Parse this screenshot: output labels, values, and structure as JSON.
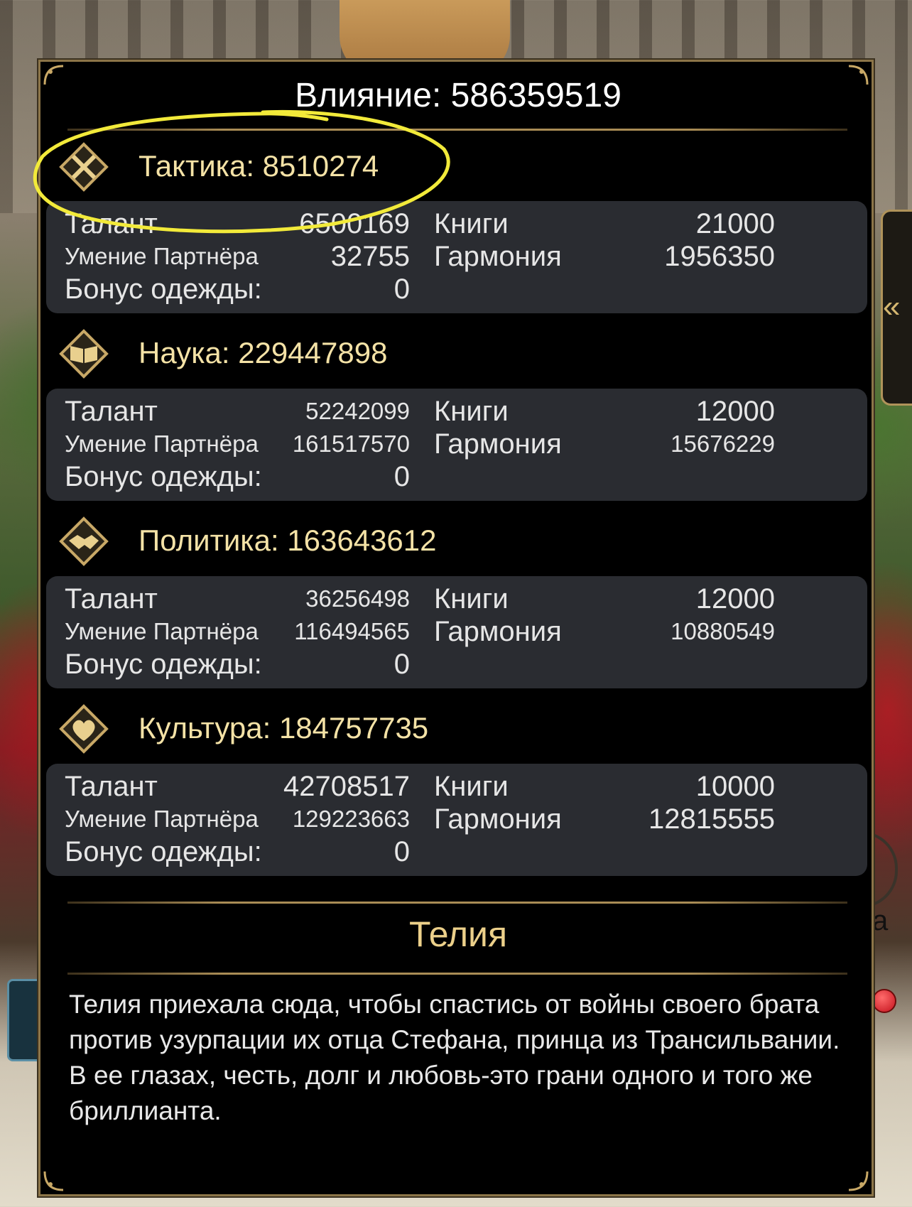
{
  "influence": {
    "label": "Влияние:",
    "value": "586359519"
  },
  "categories": [
    {
      "icon": "crossed-swords-icon",
      "title": "Тактика: 8510274",
      "talent_label": "Талант",
      "talent_value": "6500169",
      "skill_label": "Умение Партнёра",
      "skill_value": "32755",
      "dress_label": "Бонус одежды:",
      "dress_value": "0",
      "books_label": "Книги",
      "books_value": "21000",
      "harmony_label": "Гармония",
      "harmony_value": "1956350"
    },
    {
      "icon": "open-book-icon",
      "title": "Наука: 229447898",
      "talent_label": "Талант",
      "talent_value": "52242099",
      "skill_label": "Умение Партнёра",
      "skill_value": "161517570",
      "dress_label": "Бонус одежды:",
      "dress_value": "0",
      "books_label": "Книги",
      "books_value": "12000",
      "harmony_label": "Гармония",
      "harmony_value": "15676229"
    },
    {
      "icon": "handshake-icon",
      "title": "Политика: 163643612",
      "talent_label": "Талант",
      "talent_value": "36256498",
      "skill_label": "Умение Партнёра",
      "skill_value": "116494565",
      "dress_label": "Бонус одежды:",
      "dress_value": "0",
      "books_label": "Книги",
      "books_value": "12000",
      "harmony_label": "Гармония",
      "harmony_value": "10880549"
    },
    {
      "icon": "hearts-icon",
      "title": "Культура: 184757735",
      "talent_label": "Талант",
      "talent_value": "42708517",
      "skill_label": "Умение Партнёра",
      "skill_value": "129223663",
      "dress_label": "Бонус одежды:",
      "dress_value": "0",
      "books_label": "Книги",
      "books_value": "10000",
      "harmony_label": "Гармония",
      "harmony_value": "12815555"
    }
  ],
  "character": {
    "name": "Телия",
    "description": "Телия приехала сюда, чтобы спастись от войны своего брата против узурпации их отца Стефана, принца из Трансильвании. В ее глазах, честь, долг и любовь-это грани одного и того же бриллианта."
  },
  "side": {
    "letter": "а"
  },
  "colors": {
    "gold": "#f4e2a6",
    "panel": "#000000",
    "card": "#2a2c31",
    "highlight": "#f2ea3a"
  }
}
